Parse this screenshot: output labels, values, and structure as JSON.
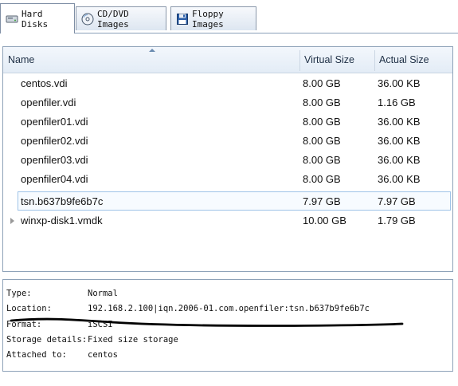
{
  "tabs": [
    {
      "label": "Hard Disks",
      "icon": "hard-disk-icon",
      "active": true
    },
    {
      "label": "CD/DVD Images",
      "icon": "cd-dvd-icon",
      "active": false
    },
    {
      "label": "Floppy Images",
      "icon": "floppy-icon",
      "active": false
    }
  ],
  "table": {
    "columns": [
      "Name",
      "Virtual Size",
      "Actual Size"
    ],
    "sort_column": "Name",
    "rows": [
      {
        "name": "centos.vdi",
        "virtual": "8.00 GB",
        "actual": "36.00 KB"
      },
      {
        "name": "openfiler.vdi",
        "virtual": "8.00 GB",
        "actual": "1.16 GB"
      },
      {
        "name": "openfiler01.vdi",
        "virtual": "8.00 GB",
        "actual": "36.00 KB"
      },
      {
        "name": "openfiler02.vdi",
        "virtual": "8.00 GB",
        "actual": "36.00 KB"
      },
      {
        "name": "openfiler03.vdi",
        "virtual": "8.00 GB",
        "actual": "36.00 KB"
      },
      {
        "name": "openfiler04.vdi",
        "virtual": "8.00 GB",
        "actual": "36.00 KB"
      },
      {
        "name": "tsn.b637b9fe6b7c",
        "virtual": "7.97 GB",
        "actual": "7.97 GB",
        "selected": true
      },
      {
        "name": "winxp-disk1.vmdk",
        "virtual": "10.00 GB",
        "actual": "1.79 GB",
        "expandable": true
      }
    ]
  },
  "details": {
    "type_label": "Type:",
    "type_value": "Normal",
    "location_label": "Location:",
    "location_value": "192.168.2.100|iqn.2006-01.com.openfiler:tsn.b637b9fe6b7c",
    "format_label": "Format:",
    "format_value": "iSCSI",
    "storage_label": "Storage details:",
    "storage_value": "Fixed size storage",
    "attached_label": "Attached to:",
    "attached_value": "centos"
  },
  "colors": {
    "selection_border": "#9fc3e8",
    "header_bg": "#e3ecf6",
    "annotation_stroke": "#000000"
  }
}
